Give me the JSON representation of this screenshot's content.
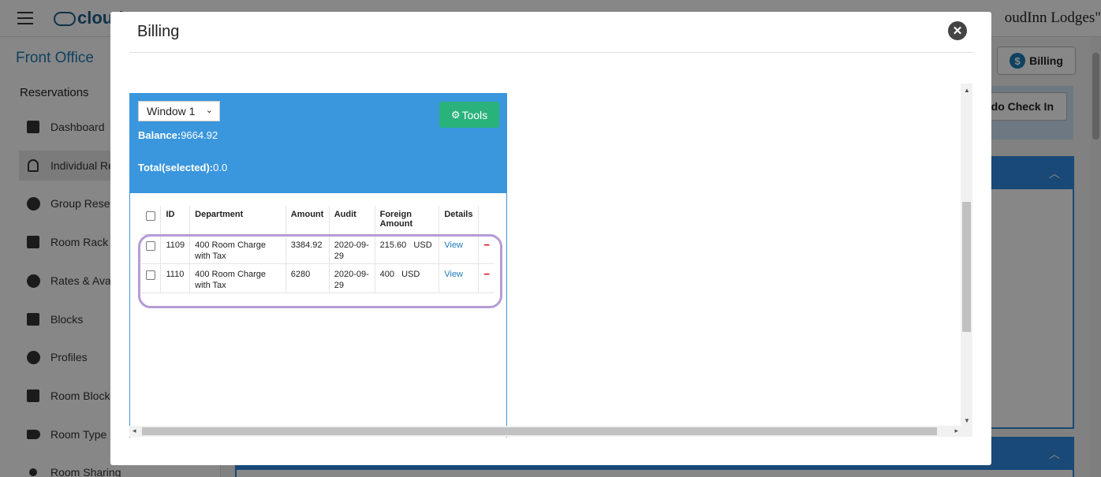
{
  "app": {
    "logo_text": "cloud",
    "hotel_name": "oudInn Lodges\"",
    "menu_icon": "hamburger-icon"
  },
  "sidebar": {
    "section_title": "Front Office",
    "group_title": "Reservations",
    "items": [
      {
        "label": "Dashboard",
        "icon": "dashboard-icon"
      },
      {
        "label": "Individual Re",
        "icon": "person-icon",
        "active": true
      },
      {
        "label": "Group Reser",
        "icon": "group-icon"
      },
      {
        "label": "Room Rack",
        "icon": "list-icon"
      },
      {
        "label": "Rates & Ava",
        "icon": "dollar-icon"
      },
      {
        "label": "Blocks",
        "icon": "blocks-icon"
      },
      {
        "label": "Profiles",
        "icon": "profile-icon"
      },
      {
        "label": "Room Block",
        "icon": "grid-icon"
      },
      {
        "label": "Room Type (",
        "icon": "tag-icon"
      },
      {
        "label": "Room Sharing",
        "icon": "share-icon"
      }
    ]
  },
  "main": {
    "billing_button": "Billing",
    "undo_button": "ndo Check In"
  },
  "modal": {
    "title": "Billing",
    "close_icon": "close-icon",
    "folio": {
      "window_select": "Window 1",
      "tools_label": "Tools",
      "balance_label": "Balance:",
      "balance_value": "9664.92",
      "total_label": "Total(selected):",
      "total_value": "0.0",
      "columns": [
        "ID",
        "Department",
        "Amount",
        "Audit",
        "Foreign Amount",
        "Details"
      ],
      "rows": [
        {
          "id": "1109",
          "department": "400 Room Charge with Tax",
          "amount": "3384.92",
          "audit": "2020-09-29",
          "foreign_amount": "215.60",
          "currency": "USD",
          "details": "View",
          "remove": "−"
        },
        {
          "id": "1110",
          "department": "400 Room Charge with Tax",
          "amount": "6280",
          "audit": "2020-09-29",
          "foreign_amount": "400",
          "currency": "USD",
          "details": "View",
          "remove": "−"
        }
      ]
    }
  },
  "colors": {
    "folio_header": "#3a96dd",
    "tools_button": "#2ab27b",
    "highlight": "#b59cd6",
    "link": "#1e7bb6"
  }
}
